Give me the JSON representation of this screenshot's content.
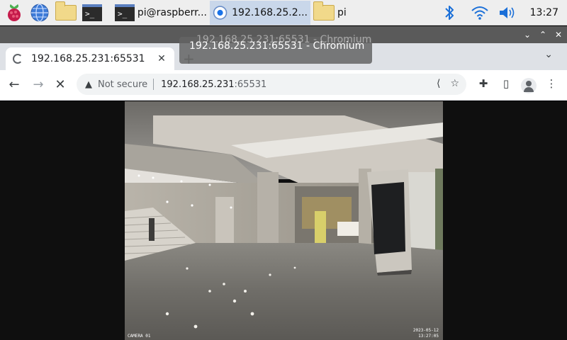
{
  "taskbar": {
    "tasks": [
      {
        "label": "pi@raspberr..."
      },
      {
        "label": "192.168.25.2..."
      },
      {
        "label": "pi"
      }
    ],
    "clock": "13:27"
  },
  "tooltip": {
    "text": "192.168.25.231:65531 - Chromium"
  },
  "tab": {
    "title": "192.168.25.231:65531",
    "close_label": "✕"
  },
  "omnibox": {
    "security_label": "Not secure",
    "url_host": "192.168.25.231",
    "url_port": ":65531"
  },
  "camera": {
    "timestamp_line1": "2023-05-12",
    "timestamp_line2": "13:27:05",
    "label": "CAMERA 01"
  },
  "colors": {
    "taskbar_bg": "#eeeeee",
    "titlebar_bg": "#5a5a5a",
    "tabstrip_bg": "#dee1e6",
    "content_bg": "#0f0f0f",
    "accent": "#1a73e8"
  }
}
